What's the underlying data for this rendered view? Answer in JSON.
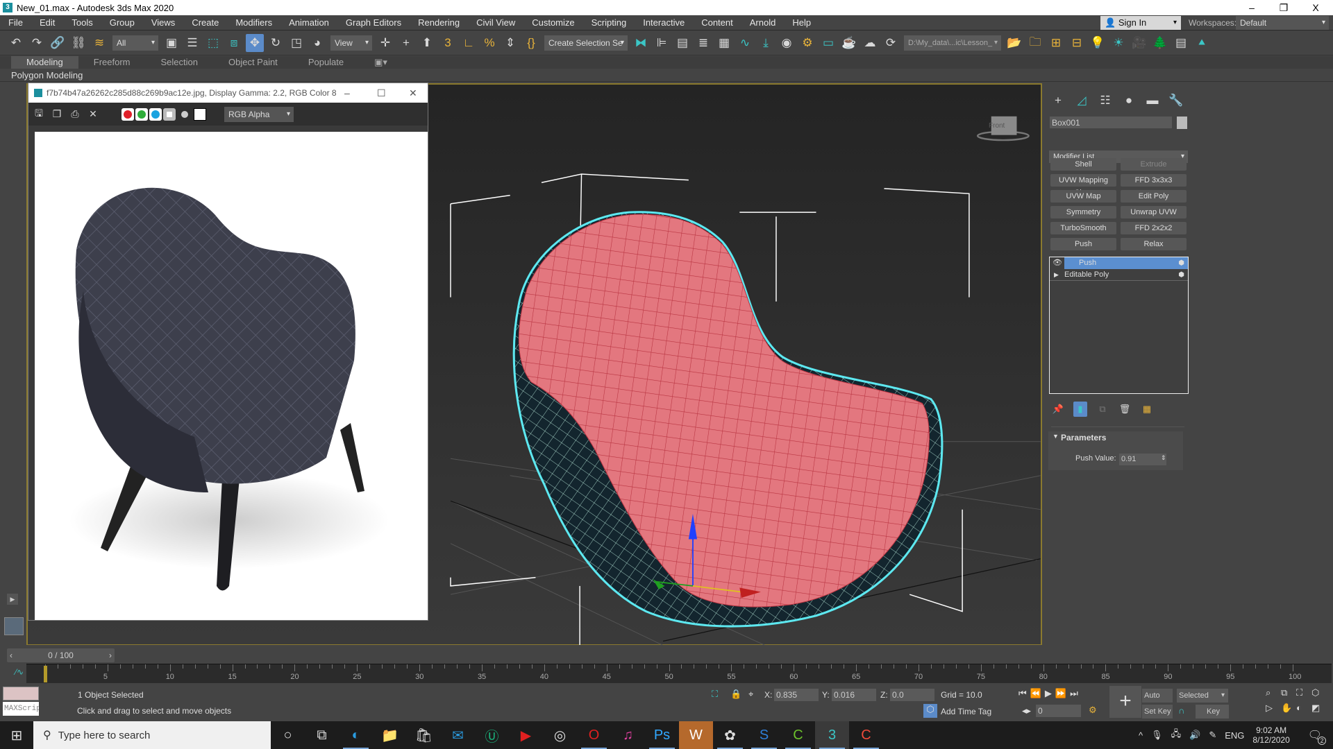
{
  "app": {
    "title": "New_01.max - Autodesk 3ds Max 2020",
    "logo": "3"
  },
  "window_controls": {
    "minimize": "–",
    "restore": "❐",
    "close": "X"
  },
  "menu": [
    "File",
    "Edit",
    "Tools",
    "Group",
    "Views",
    "Create",
    "Modifiers",
    "Animation",
    "Graph Editors",
    "Rendering",
    "Civil View",
    "Customize",
    "Scripting",
    "Interactive",
    "Content",
    "Arnold",
    "Help"
  ],
  "account": {
    "sign_in": "Sign In",
    "workspaces_label": "Workspaces:",
    "workspace": "Default"
  },
  "toolbar": {
    "selection_filter": "All",
    "ref_coord": "View",
    "named_selection": "Create Selection Se",
    "project_path": "D:\\My_data\\...ic\\Lesson_",
    "icons_left": [
      "undo-icon",
      "redo-icon",
      "link-icon",
      "unlink-icon",
      "bind-space-warp-icon"
    ],
    "icons_mid": [
      "select-object-icon",
      "select-by-name-icon",
      "rect-selection-icon",
      "window-crossing-icon",
      "move-icon",
      "rotate-icon",
      "scale-icon",
      "place-icon"
    ],
    "icons_snap": [
      "pivot-icon",
      "manipulate-icon",
      "keyboard-shortcut-icon",
      "snap-3d-icon",
      "angle-snap-icon",
      "percent-snap-icon",
      "spinner-snap-icon",
      "edit-named-sel-icon"
    ],
    "icons_right": [
      "mirror-icon",
      "align-icon",
      "layer-explorer-icon",
      "toggle-ribbon-icon",
      "scene-explorer-icon",
      "curve-editor-icon",
      "dope-sheet-icon",
      "material-editor-icon",
      "render-setup-icon",
      "rendered-frame-icon",
      "render-icon",
      "render-cloud-icon",
      "render-iterative-icon"
    ],
    "icons_far": [
      "open-folder-icon",
      "project-folder-icon",
      "hierarchy-icon",
      "asset-icon",
      "light-icon",
      "sun-icon",
      "camera-icon",
      "tree-icon",
      "list-icon",
      "pine-icon"
    ]
  },
  "ribbon": {
    "tabs": [
      "Modeling",
      "Freeform",
      "Selection",
      "Object Paint",
      "Populate"
    ],
    "active": "Modeling",
    "panel": "Polygon Modeling"
  },
  "frame_window": {
    "title": "f7b74b47a26262c285d88c269b9ac12e.jpg, Display Gamma: 2.2, RGB Color 8 ...",
    "channel": "RGB Alpha",
    "channel_colors": {
      "red": "#e0202a",
      "green": "#2fae3a",
      "blue": "#1aa3e0"
    }
  },
  "viewport": {
    "viewcube_label": "Front",
    "colors": {
      "selection": "#5de8f0",
      "mesh": "#e0737b",
      "frame": "#8b7a2e"
    }
  },
  "command_panel": {
    "object_name": "Box001",
    "modifier_list": "Modifier List",
    "modifier_buttons": [
      "Shell",
      "Extrude",
      "UVW Mapping Clear",
      "FFD 3x3x3",
      "UVW Map",
      "Edit Poly",
      "Symmetry",
      "Unwrap UVW",
      "TurboSmooth",
      "FFD 2x2x2",
      "Push",
      "Relax"
    ],
    "disabled_buttons": [
      "Extrude"
    ],
    "stack": [
      {
        "label": "Push",
        "selected": true
      },
      {
        "label": "Editable Poly",
        "selected": false
      }
    ],
    "rollout_title": "Parameters",
    "push_value_label": "Push Value:",
    "push_value": "0.91"
  },
  "timeline": {
    "slider": "0 / 100",
    "start": 0,
    "end": 100,
    "label_step": 5,
    "current": 0
  },
  "status": {
    "selection": "1 Object Selected",
    "prompt": "Click and drag to select and move objects",
    "maxscript": "MAXScript Mi:",
    "x_label": "X:",
    "x": "0.835",
    "y_label": "Y:",
    "y": "0.016",
    "z_label": "Z:",
    "z": "0.0",
    "grid": "Grid = 10.0",
    "add_time_tag": "Add Time Tag",
    "frame": "0",
    "auto_key": "Auto Key",
    "set_key": "Set Key",
    "key_mode": "Selected",
    "key_filters": "Key Filters..."
  },
  "taskbar": {
    "search_placeholder": "Type here to search",
    "language": "ENG",
    "time": "9:02 AM",
    "date": "8/12/2020",
    "notifications": "2"
  }
}
